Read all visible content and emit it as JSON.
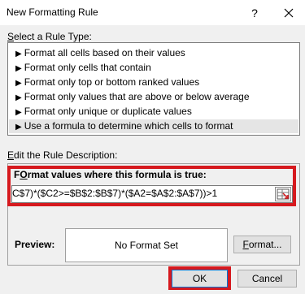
{
  "window": {
    "title": "New Formatting Rule",
    "help": "?",
    "close": "✕"
  },
  "rule_type": {
    "label_accel": "S",
    "label_rest": "elect a Rule Type:",
    "items": [
      {
        "label": "Format all cells based on their values"
      },
      {
        "label": "Format only cells that contain"
      },
      {
        "label": "Format only top or bottom ranked values"
      },
      {
        "label": "Format only values that are above or below average"
      },
      {
        "label": "Format only unique or duplicate values"
      },
      {
        "label": "Use a formula to determine which cells to format",
        "selected": true
      }
    ],
    "bullet": "▶"
  },
  "description": {
    "label_accel": "E",
    "label_rest": "dit the Rule Description:",
    "formula_label_accel": "O",
    "formula_label_pre": "F",
    "formula_label_rest": "rmat values where this formula is true:",
    "formula_value": "C$7)*($C2>=$B$2:$B$7)*($A2=$A$2:$A$7))>1",
    "preview_label": "Preview:",
    "preview_text": "No Format Set",
    "format_button_accel": "F",
    "format_button_rest": "ormat..."
  },
  "footer": {
    "ok_label": "OK",
    "cancel_label": "Cancel"
  }
}
